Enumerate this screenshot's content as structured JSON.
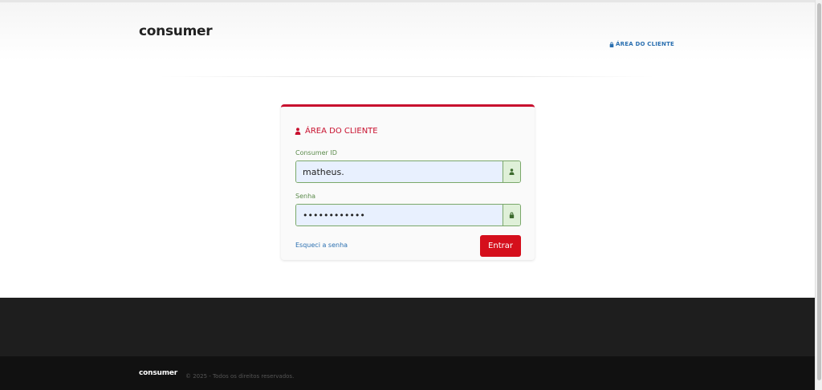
{
  "header": {
    "logo": "consumer",
    "client_area_link": "ÁREA DO CLIENTE"
  },
  "login": {
    "title": "ÁREA DO CLIENTE",
    "id_label": "Consumer ID",
    "id_value": "matheus.",
    "password_label": "Senha",
    "password_value": "••••••••••••",
    "forgot_link": "Esqueci a senha",
    "submit_label": "Entrar"
  },
  "footer": {
    "logo": "consumer",
    "copyright": "© 2025 - Todos os direitos reservados."
  },
  "colors": {
    "brand_red": "#d50f1c",
    "link_blue": "#2a6fb0",
    "valid_green": "#7aa86a",
    "autofill_blue": "#e8f0fe"
  },
  "icons": {
    "client_area": "lock-icon",
    "title": "user-icon",
    "id_addon": "user-icon",
    "password_addon": "lock-icon"
  }
}
